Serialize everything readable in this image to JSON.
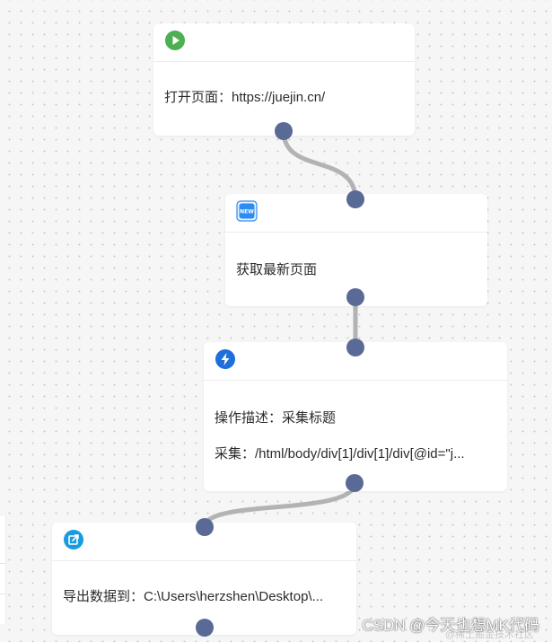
{
  "nodes": [
    {
      "icon": "play-icon",
      "lines": [
        "打开页面：https://juejin.cn/"
      ]
    },
    {
      "icon": "new-badge-icon",
      "badge_text": "NEW",
      "lines": [
        "获取最新页面"
      ]
    },
    {
      "icon": "lightning-icon",
      "lines": [
        "操作描述：采集标题",
        "采集：/html/body/div[1]/div[1]/div[@id=\"j..."
      ]
    },
    {
      "icon": "export-icon",
      "lines": [
        "导出数据到：C:\\Users\\herzshen\\Desktop\\..."
      ]
    }
  ],
  "colors": {
    "port": "#5a6a96",
    "connector": "#b3b3b3",
    "play": "#4caf50",
    "new_badge": "#2d8cf0",
    "lightning": "#1e6fd9",
    "export": "#1a9be0"
  },
  "watermark": {
    "main": "CSDN @今天也想MK代码",
    "sub": "@稀土掘金技术社区"
  }
}
